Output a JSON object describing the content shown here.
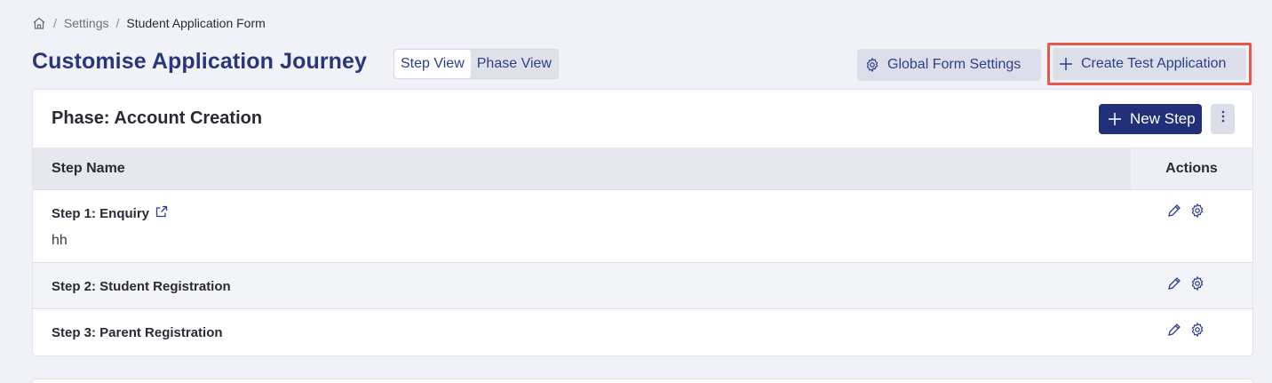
{
  "breadcrumb": {
    "items": [
      "Settings",
      "Student Application Form"
    ],
    "separator": "/"
  },
  "header": {
    "title": "Customise Application Journey",
    "view_toggle": {
      "options": [
        "Step View",
        "Phase View"
      ],
      "active": "Step View"
    },
    "global_settings_label": "Global Form Settings",
    "create_test_label": "Create Test Application"
  },
  "phase": {
    "title": "Phase: Account Creation",
    "new_step_label": "New Step",
    "columns": {
      "name": "Step Name",
      "actions": "Actions"
    },
    "steps": [
      {
        "name": "Step 1: Enquiry",
        "description": "hh",
        "external_link": true
      },
      {
        "name": "Step 2: Student Registration"
      },
      {
        "name": "Step 3: Parent Registration"
      }
    ]
  },
  "colors": {
    "brand": "#27377a",
    "primary_button": "#22307a",
    "highlight": "#e8574a",
    "background": "#f1f2f8"
  },
  "icons": [
    "home-icon",
    "gear-icon",
    "plus-icon",
    "kebab-icon",
    "external-link-icon",
    "pencil-icon",
    "gear-icon"
  ]
}
